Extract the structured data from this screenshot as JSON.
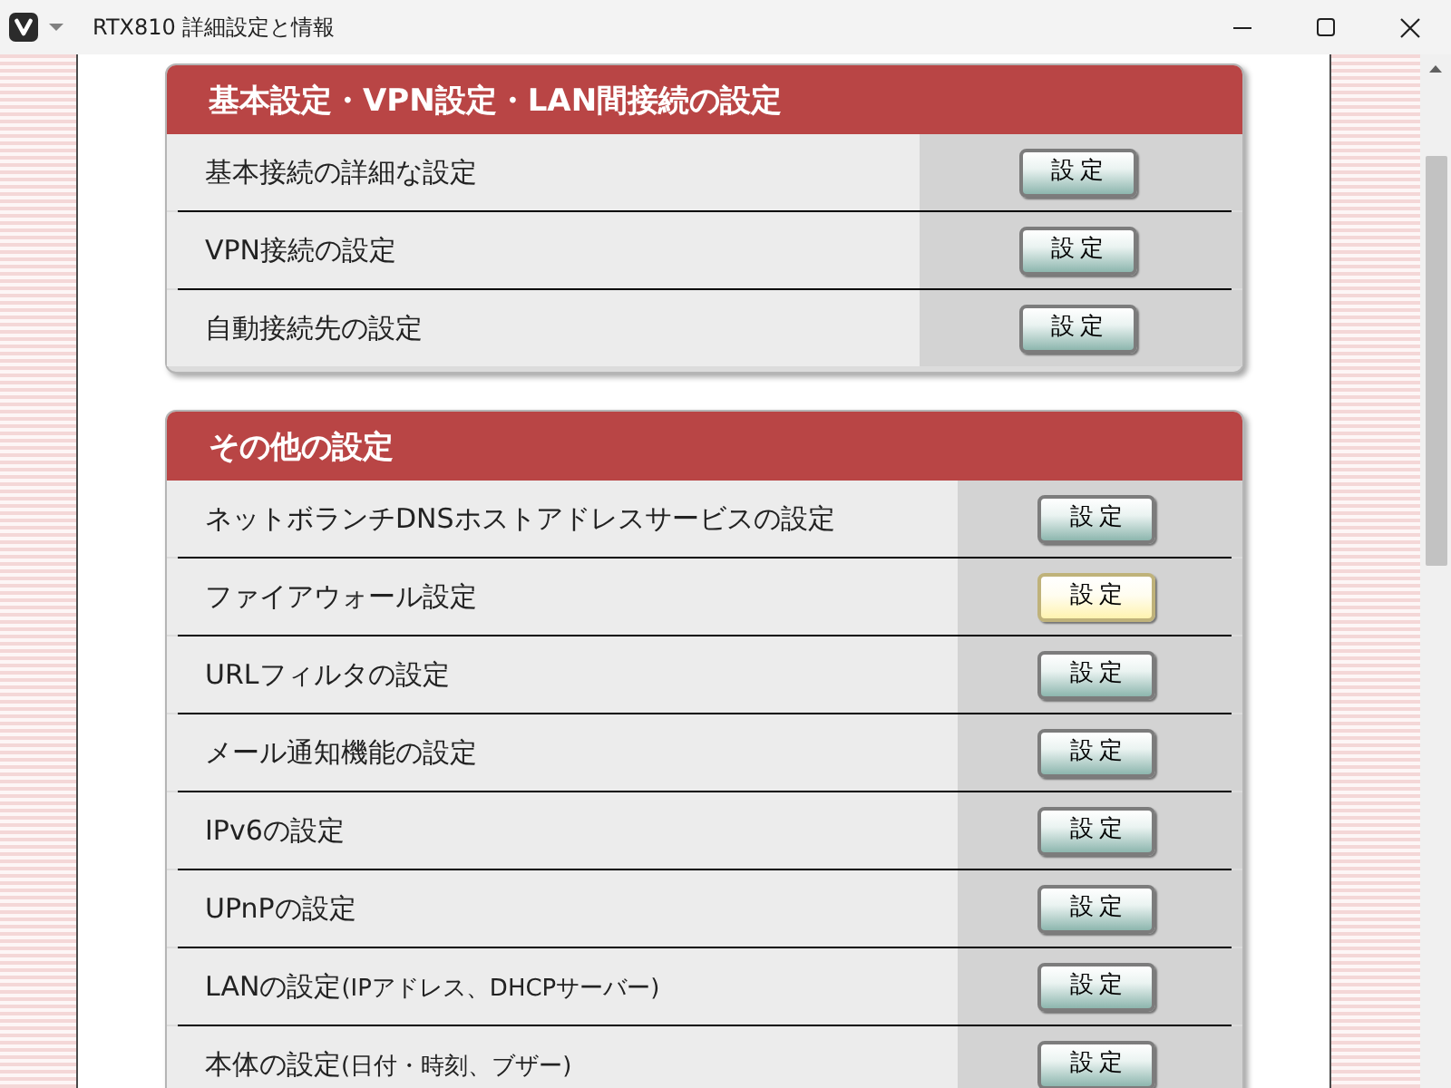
{
  "window": {
    "title": "RTX810 詳細設定と情報"
  },
  "sections": [
    {
      "title": "基本設定・VPN設定・LAN間接続の設定",
      "rows": [
        {
          "label": "基本接続の詳細な設定",
          "button": "設定",
          "highlighted": false
        },
        {
          "label": "VPN接続の設定",
          "button": "設定",
          "highlighted": false
        },
        {
          "label": "自動接続先の設定",
          "button": "設定",
          "highlighted": false
        }
      ]
    },
    {
      "title": "その他の設定",
      "rows": [
        {
          "label": "ネットボランチDNSホストアドレスサービスの設定",
          "button": "設定",
          "highlighted": false
        },
        {
          "label": "ファイアウォール設定",
          "button": "設定",
          "highlighted": true
        },
        {
          "label": "URLフィルタの設定",
          "button": "設定",
          "highlighted": false
        },
        {
          "label": "メール通知機能の設定",
          "button": "設定",
          "highlighted": false
        },
        {
          "label": "IPv6の設定",
          "button": "設定",
          "highlighted": false
        },
        {
          "label": "UPnPの設定",
          "button": "設定",
          "highlighted": false
        },
        {
          "label": "LANの設定",
          "note": "(IPアドレス、DHCPサーバー)",
          "button": "設定",
          "highlighted": false
        },
        {
          "label": "本体の設定",
          "note": "(日付・時刻、ブザー)",
          "button": "設定",
          "highlighted": false
        }
      ]
    }
  ]
}
